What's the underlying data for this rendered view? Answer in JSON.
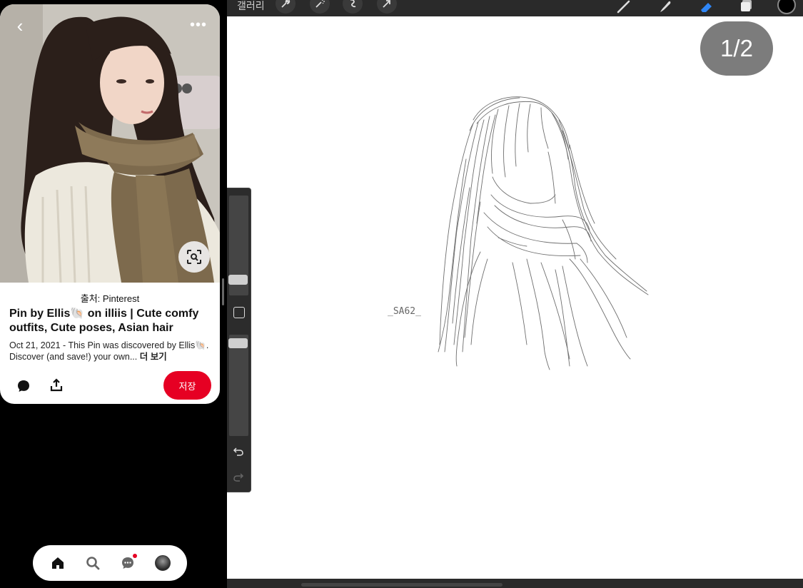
{
  "pinterest": {
    "source_label": "출처: Pinterest",
    "pin_title": "Pin by Ellis🐚 on illiis | Cute comfy outfits, Cute poses, Asian hair",
    "pin_description": "Oct 21, 2021 - This Pin was discovered by Ellis🐚. Discover (and save!) your own...",
    "more_label": "더 보기",
    "save_label": "저장",
    "back_icon": "chevron-left-icon",
    "more_icon": "ellipsis-icon",
    "lens_icon": "visual-search-icon",
    "nav": [
      {
        "name": "home",
        "icon": "home-icon"
      },
      {
        "name": "search",
        "icon": "search-icon"
      },
      {
        "name": "messages",
        "icon": "chat-icon",
        "badge": true
      },
      {
        "name": "profile",
        "icon": "avatar"
      }
    ],
    "accent_color": "#e60023"
  },
  "procreate": {
    "gallery_label": "갤러리",
    "page_counter": "1/2",
    "signature": "_SA62_",
    "toolbar_icons": [
      "wrench-icon",
      "magic-wand-icon",
      "selection-icon",
      "transform-arrow-icon"
    ],
    "tool_icons": [
      "brush-icon",
      "smudge-icon",
      "eraser-icon",
      "layers-icon"
    ],
    "color_swatch": "#000000",
    "active_tool_color": "#2f86f6"
  }
}
